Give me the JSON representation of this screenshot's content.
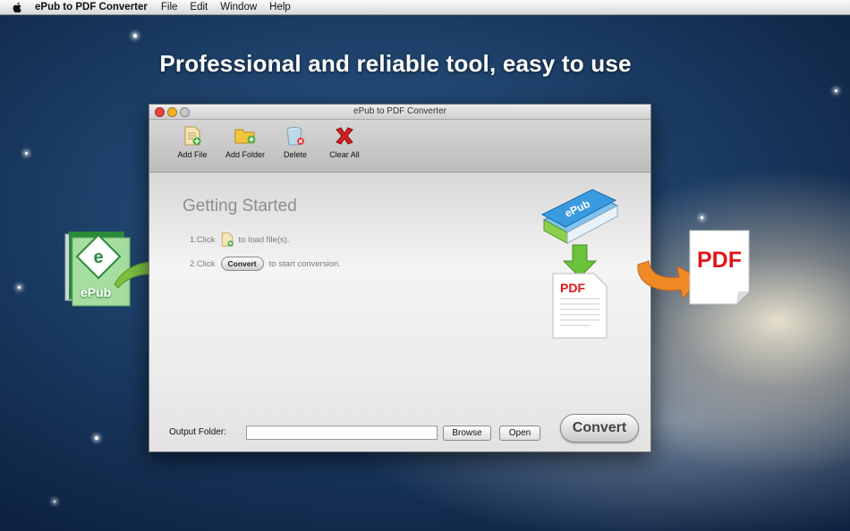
{
  "menubar": {
    "app_name": "ePub to PDF Converter",
    "items": [
      "File",
      "Edit",
      "Window",
      "Help"
    ]
  },
  "headline": "Professional and reliable tool, easy to use",
  "window": {
    "title": "ePub to PDF Converter",
    "toolbar": {
      "add_file": "Add File",
      "add_folder": "Add Folder",
      "delete": "Delete",
      "clear_all": "Clear All"
    },
    "getting_started": {
      "title": "Getting Started",
      "step1_prefix": "1.Click",
      "step1_suffix": "to load file(s).",
      "step2_prefix": "2.Click",
      "step2_button": "Convert",
      "step2_suffix": "to start conversion."
    },
    "output": {
      "label": "Output Folder:",
      "value": "",
      "browse": "Browse",
      "open": "Open",
      "convert": "Convert"
    }
  },
  "graphics": {
    "epub_label": "ePub",
    "pdf_label": "PDF",
    "accent_green": "#7cc142",
    "accent_orange": "#f08a24",
    "pdf_red": "#e0151b"
  }
}
